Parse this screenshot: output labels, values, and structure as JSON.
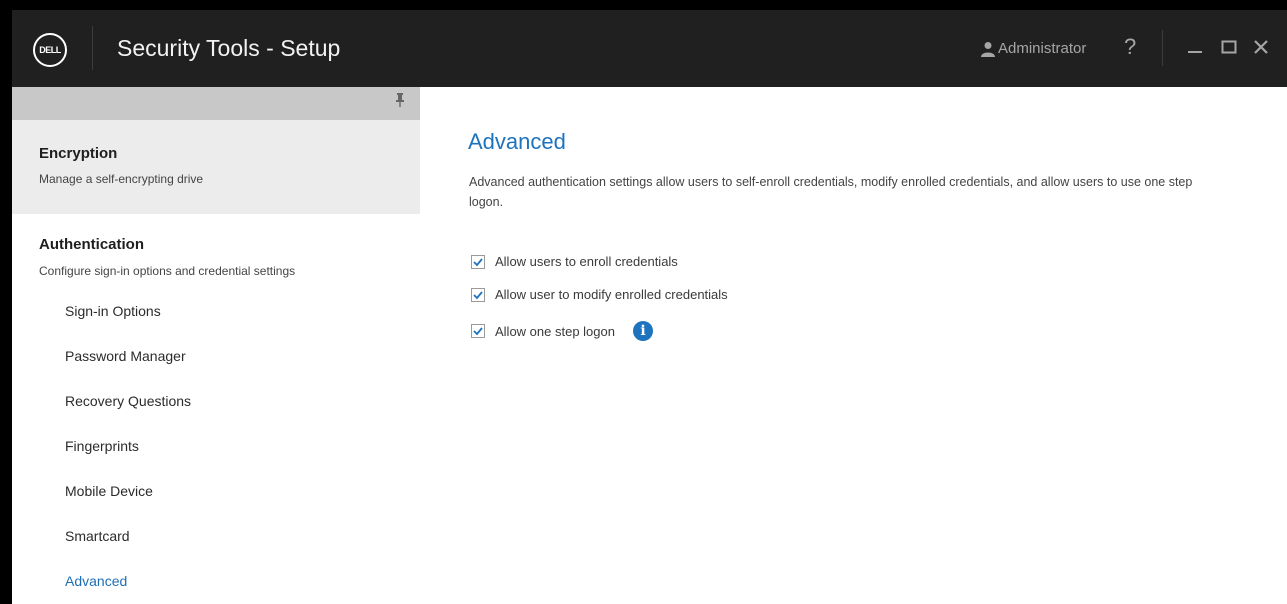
{
  "titlebar": {
    "logo_text": "DELL",
    "title": "Security Tools - Setup",
    "user": "Administrator",
    "help": "?"
  },
  "sidebar": {
    "encryption": {
      "title": "Encryption",
      "subtitle": "Manage a self-encrypting drive"
    },
    "authentication": {
      "title": "Authentication",
      "subtitle": "Configure sign-in options and credential settings"
    },
    "items": [
      {
        "label": "Sign-in Options"
      },
      {
        "label": "Password Manager"
      },
      {
        "label": "Recovery Questions"
      },
      {
        "label": "Fingerprints"
      },
      {
        "label": "Mobile Device"
      },
      {
        "label": "Smartcard"
      },
      {
        "label": "Advanced",
        "active": true
      }
    ]
  },
  "content": {
    "title": "Advanced",
    "description": "Advanced authentication settings allow users to self-enroll credentials, modify enrolled credentials, and allow users to use one step logon.",
    "options": [
      {
        "label": "Allow users to enroll credentials",
        "checked": true
      },
      {
        "label": "Allow user to modify enrolled credentials",
        "checked": true
      },
      {
        "label": "Allow one step logon",
        "checked": true
      }
    ]
  },
  "colors": {
    "accent": "#1e73be",
    "titlebar_bg": "#202020",
    "pinbar_bg": "#c8c8c8",
    "selected_section_bg": "#ececec"
  },
  "icons": [
    "dell-logo-icon",
    "user-icon",
    "help-icon",
    "minimize-icon",
    "maximize-icon",
    "close-icon",
    "pin-icon",
    "checkmark-icon",
    "info-icon"
  ]
}
